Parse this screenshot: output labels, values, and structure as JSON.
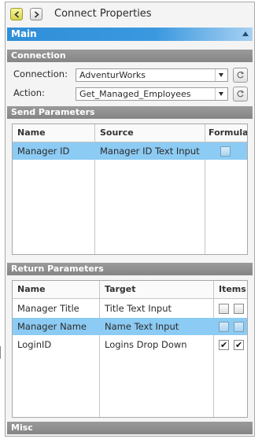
{
  "window": {
    "title": "Connect Properties"
  },
  "main_header": "Main",
  "connection_section": {
    "header": "Connection",
    "connection_label": "Connection:",
    "connection_value": "AdventurWorks",
    "action_label": "Action:",
    "action_value": "Get_Managed_Employees"
  },
  "send_parameters": {
    "header": "Send Parameters",
    "columns": [
      "Name",
      "Source",
      "Formula"
    ],
    "rows": [
      {
        "name": "Manager ID",
        "source": "Manager ID Text Input",
        "formula": false,
        "selected": true
      }
    ]
  },
  "return_parameters": {
    "header": "Return Parameters",
    "columns": [
      "Name",
      "Target",
      "Items"
    ],
    "rows": [
      {
        "name": "Manager Title",
        "target": "Title Text Input",
        "items": [
          false,
          false
        ],
        "selected": false
      },
      {
        "name": "Manager Name",
        "target": "Name Text Input",
        "items": [
          false,
          false
        ],
        "selected": true
      },
      {
        "name": "LoginID",
        "target": "Logins Drop Down",
        "items": [
          true,
          true
        ],
        "selected": false
      }
    ]
  },
  "misc_header": "Misc",
  "colors": {
    "accent": "#3a98df",
    "selection": "#8ccbf3",
    "section_header": "#8f8f8f"
  },
  "icons": {
    "back": "back-arrow-icon",
    "forward": "forward-arrow-icon",
    "refresh": "refresh-icon",
    "collapse": "collapse-up-icon",
    "dropdown": "chevron-down-icon"
  }
}
